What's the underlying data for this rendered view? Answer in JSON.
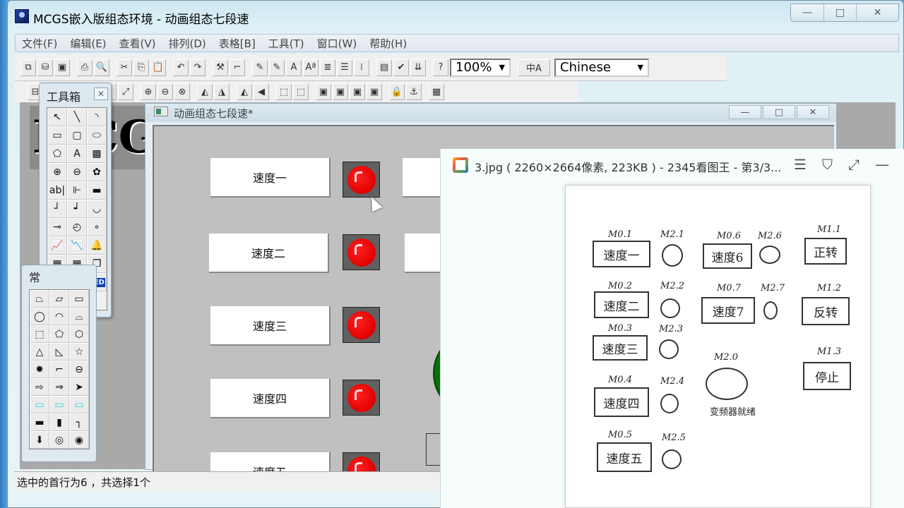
{
  "app": {
    "title": "MCGS嵌入版组态环境 - 动画组态七段速",
    "controls": {
      "minimize": "—",
      "maximize": "□",
      "close": "✕"
    }
  },
  "menu": [
    "文件(F)",
    "编辑(E)",
    "查看(V)",
    "排列(D)",
    "表格[B]",
    "工具(T)",
    "窗口(W)",
    "帮助(H)"
  ],
  "toolbar": {
    "zoom_value": "100%",
    "language_value": "Chinese",
    "row1_icons": [
      "new-window-icon",
      "database-icon",
      "save-icon",
      "print-icon",
      "print-preview-icon",
      "cut-icon",
      "copy-icon",
      "paste-icon",
      "undo-icon",
      "redo-icon",
      "tools-icon",
      "frame-icon",
      "font-color-icon",
      "fill-color-icon",
      "text-color-icon",
      "font-size-icon",
      "line-style-icon",
      "align-icon",
      "grid-icon",
      "properties-icon",
      "check-icon",
      "sort-icon",
      "help-icon"
    ],
    "row1_glyphs": [
      "⧉",
      "⛁",
      "▣",
      "⎙",
      "🔍",
      "✂",
      "⎘",
      "📋",
      "↶",
      "↷",
      "⚒",
      "⌐",
      "✎",
      "✎",
      "A",
      "Aª",
      "≣",
      "☰",
      "⁞",
      "▤",
      "✔",
      "⇊",
      "?"
    ],
    "row2_icons": [
      "align-left-icon",
      "align-center-icon",
      "align-middle-icon",
      "same-width-icon",
      "same-height-icon",
      "same-size-icon",
      "center-h-icon",
      "center-v-icon",
      "center-both-icon",
      "rotate-left-icon",
      "rotate-right-icon",
      "flip-h-icon",
      "flip-v-icon",
      "group-icon",
      "ungroup-icon",
      "bring-front-icon",
      "send-back-icon",
      "bring-forward-icon",
      "send-backward-icon",
      "lock-icon",
      "anchor-icon",
      "palette-icon"
    ],
    "row2_glyphs": [
      "⊟",
      "⊞",
      "⊠",
      "⟷",
      "↕",
      "⤢",
      "⊕",
      "⊖",
      "⊗",
      "◭",
      "◮",
      "◭",
      "◀",
      "⬚",
      "⬚",
      "▣",
      "▣",
      "▣",
      "▣",
      "🔒",
      "⚓",
      "▦"
    ],
    "chinese_input_label": "中A"
  },
  "toolbox": {
    "title": "工具箱",
    "close": "✕",
    "tools": [
      {
        "name": "pointer",
        "glyph": "↖"
      },
      {
        "name": "line",
        "glyph": "╲"
      },
      {
        "name": "arc",
        "glyph": "◝"
      },
      {
        "name": "rectangle",
        "glyph": "▭"
      },
      {
        "name": "rounded-rect",
        "glyph": "▢"
      },
      {
        "name": "ellipse",
        "glyph": "⬭"
      },
      {
        "name": "polygon",
        "glyph": "⬠"
      },
      {
        "name": "label",
        "glyph": "A"
      },
      {
        "name": "bitmap",
        "glyph": "▩"
      },
      {
        "name": "insert-element",
        "glyph": "⊕"
      },
      {
        "name": "save-element",
        "glyph": "⊖"
      },
      {
        "name": "element-library",
        "glyph": "✿"
      },
      {
        "name": "input-box",
        "glyph": "ab|"
      },
      {
        "name": "slider",
        "glyph": "⊩"
      },
      {
        "name": "flow-bar",
        "glyph": "▬"
      },
      {
        "name": "pipe-corner",
        "glyph": "┘"
      },
      {
        "name": "pipe-step",
        "glyph": "┙"
      },
      {
        "name": "rotate",
        "glyph": "◡"
      },
      {
        "name": "switch",
        "glyph": "⊸"
      },
      {
        "name": "gauge",
        "glyph": "◴"
      },
      {
        "name": "indicator",
        "glyph": "∘"
      },
      {
        "name": "trend-chart",
        "glyph": "📈"
      },
      {
        "name": "history-trend",
        "glyph": "📉"
      },
      {
        "name": "alarm",
        "glyph": "🔔"
      },
      {
        "name": "table",
        "glyph": "▦"
      },
      {
        "name": "data-table",
        "glyph": "▦"
      },
      {
        "name": "stack",
        "glyph": "❐"
      },
      {
        "name": "curve",
        "glyph": "〰"
      },
      {
        "name": "panel",
        "glyph": "▤"
      },
      {
        "name": "led",
        "glyph": "LED"
      },
      {
        "name": "alarm-bar",
        "glyph": "⍓"
      }
    ]
  },
  "palette": {
    "title": "常",
    "shapes": [
      {
        "name": "trapezoid",
        "glyph": "⏢"
      },
      {
        "name": "shape-2",
        "glyph": "▱"
      },
      {
        "name": "shape-3",
        "glyph": "▭"
      },
      {
        "name": "circle",
        "glyph": "◯"
      },
      {
        "name": "speech",
        "glyph": "◠"
      },
      {
        "name": "bracket",
        "glyph": "⌓"
      },
      {
        "name": "cube",
        "glyph": "⬚"
      },
      {
        "name": "pentagon",
        "glyph": "⬠"
      },
      {
        "name": "hexagon",
        "glyph": "⬡"
      },
      {
        "name": "triangle",
        "glyph": "△"
      },
      {
        "name": "right-triangle",
        "glyph": "◺"
      },
      {
        "name": "star",
        "glyph": "☆"
      },
      {
        "name": "gear",
        "glyph": "✹"
      },
      {
        "name": "step-shape",
        "glyph": "⌐"
      },
      {
        "name": "cylinder",
        "glyph": "⊖"
      },
      {
        "name": "arrow-pentagon",
        "glyph": "⇨"
      },
      {
        "name": "arrow-right",
        "glyph": "⇒"
      },
      {
        "name": "arrowhead",
        "glyph": "➤"
      },
      {
        "name": "cyan-rect-1",
        "glyph": "▭"
      },
      {
        "name": "cyan-rect-2",
        "glyph": "▭"
      },
      {
        "name": "cyan-rect-3",
        "glyph": "▭"
      },
      {
        "name": "h-bar",
        "glyph": "▬"
      },
      {
        "name": "v-bar",
        "glyph": "▮"
      },
      {
        "name": "corner",
        "glyph": "┐"
      },
      {
        "name": "probe",
        "glyph": "⬇"
      },
      {
        "name": "ring",
        "glyph": "◎"
      },
      {
        "name": "donut",
        "glyph": "◉"
      }
    ]
  },
  "document": {
    "title": "动画组态七段速*",
    "buttons": [
      "速度一",
      "速度二",
      "速度三",
      "速度四",
      "速度五"
    ],
    "lamps": [
      {
        "state": "red"
      },
      {
        "state": "red"
      },
      {
        "state": "red"
      },
      {
        "state": "red"
      },
      {
        "state": "red"
      }
    ]
  },
  "logo_text": "MCG",
  "status": {
    "text": "选中的首行为6 ，共选择1个"
  },
  "viewer": {
    "title": "3.jpg ( 2260×2664像素, 223KB ) - 2345看图王 - 第3/3...",
    "controls": {
      "menu": "☰",
      "skin": "⛉",
      "fullscreen": "⤢",
      "minimize": "—"
    },
    "sketch": {
      "buttons": [
        {
          "addr": "M0.1",
          "label": "速度一"
        },
        {
          "addr": "M0.2",
          "label": "速度二"
        },
        {
          "addr": "M0.3",
          "label": "速度三"
        },
        {
          "addr": "M0.4",
          "label": "速度四"
        },
        {
          "addr": "M0.5",
          "label": "速度五"
        },
        {
          "addr": "M0.6",
          "label": "速度6"
        },
        {
          "addr": "M0.7",
          "label": "速度7"
        },
        {
          "addr": "M1.1",
          "label": "正转"
        },
        {
          "addr": "M1.2",
          "label": "反转"
        },
        {
          "addr": "M1.3",
          "label": "停止"
        }
      ],
      "lamps": [
        "M2.1",
        "M2.2",
        "M2.3",
        "M2.4",
        "M2.5",
        "M2.6",
        "M2.7"
      ],
      "big_lamp": {
        "addr": "M2.0",
        "caption": "变频器就绪"
      }
    }
  },
  "colors": {
    "lamp_red": "#e00000",
    "green_indicator": "#0a6e0a",
    "canvas_bg": "#c0c0c0"
  }
}
